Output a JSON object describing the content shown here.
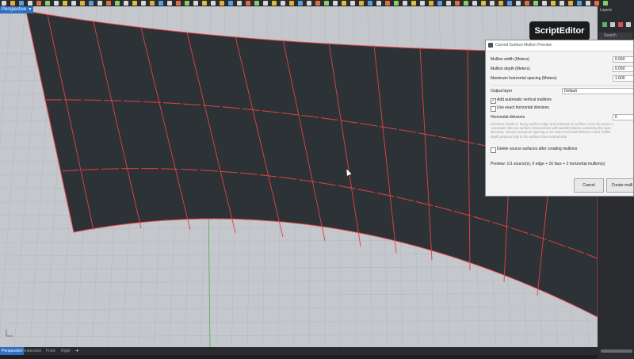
{
  "viewport": {
    "label": "Perspective",
    "tabs": [
      "Perspective",
      "Perspective",
      "Front",
      "Right"
    ],
    "add_tab": "+"
  },
  "script_badge": "ScriptEditor",
  "right_panel": {
    "title": "Layers",
    "search_placeholder": "Search"
  },
  "dialog": {
    "title": "Curved Surface Mullion Preview",
    "fields": {
      "mullion_width": {
        "label": "Mullion width (Meters)",
        "value": "0.050"
      },
      "mullion_depth": {
        "label": "Mullion depth (Meters)",
        "value": "0.050"
      },
      "max_spacing": {
        "label": "Maximum horizontal spacing (Meters)",
        "value": "1.600"
      }
    },
    "output_layer": {
      "label": "Output layer",
      "value": "Default"
    },
    "checkbox_vertical": {
      "label": "Add automatic vertical mullions",
      "checked": true
    },
    "checkbox_exact": {
      "label": "Use exact horizontal divisions",
      "checked": false
    },
    "horizontal_divisions": {
      "label": "Horizontal divisions",
      "value": "6"
    },
    "help_lines": [
      "Direction: World Z. Every surface edge and selected on-surface curve becomes a",
      "Automatic rails are surface intersections with parallel planes containing the spec",
      "direction; choose maximum spacing or an exact horizontal division count. Mullio",
      "depth projects fully to the surface face-normal side."
    ],
    "checkbox_delete": {
      "label": "Delete source surfaces after creating mullions",
      "checked": false
    },
    "preview": "Preview: 1/1 source(s), 6 edge + 16 face + 2 horizontal mullion(s)",
    "cancel": "Cancel",
    "create": "Create mulli"
  }
}
